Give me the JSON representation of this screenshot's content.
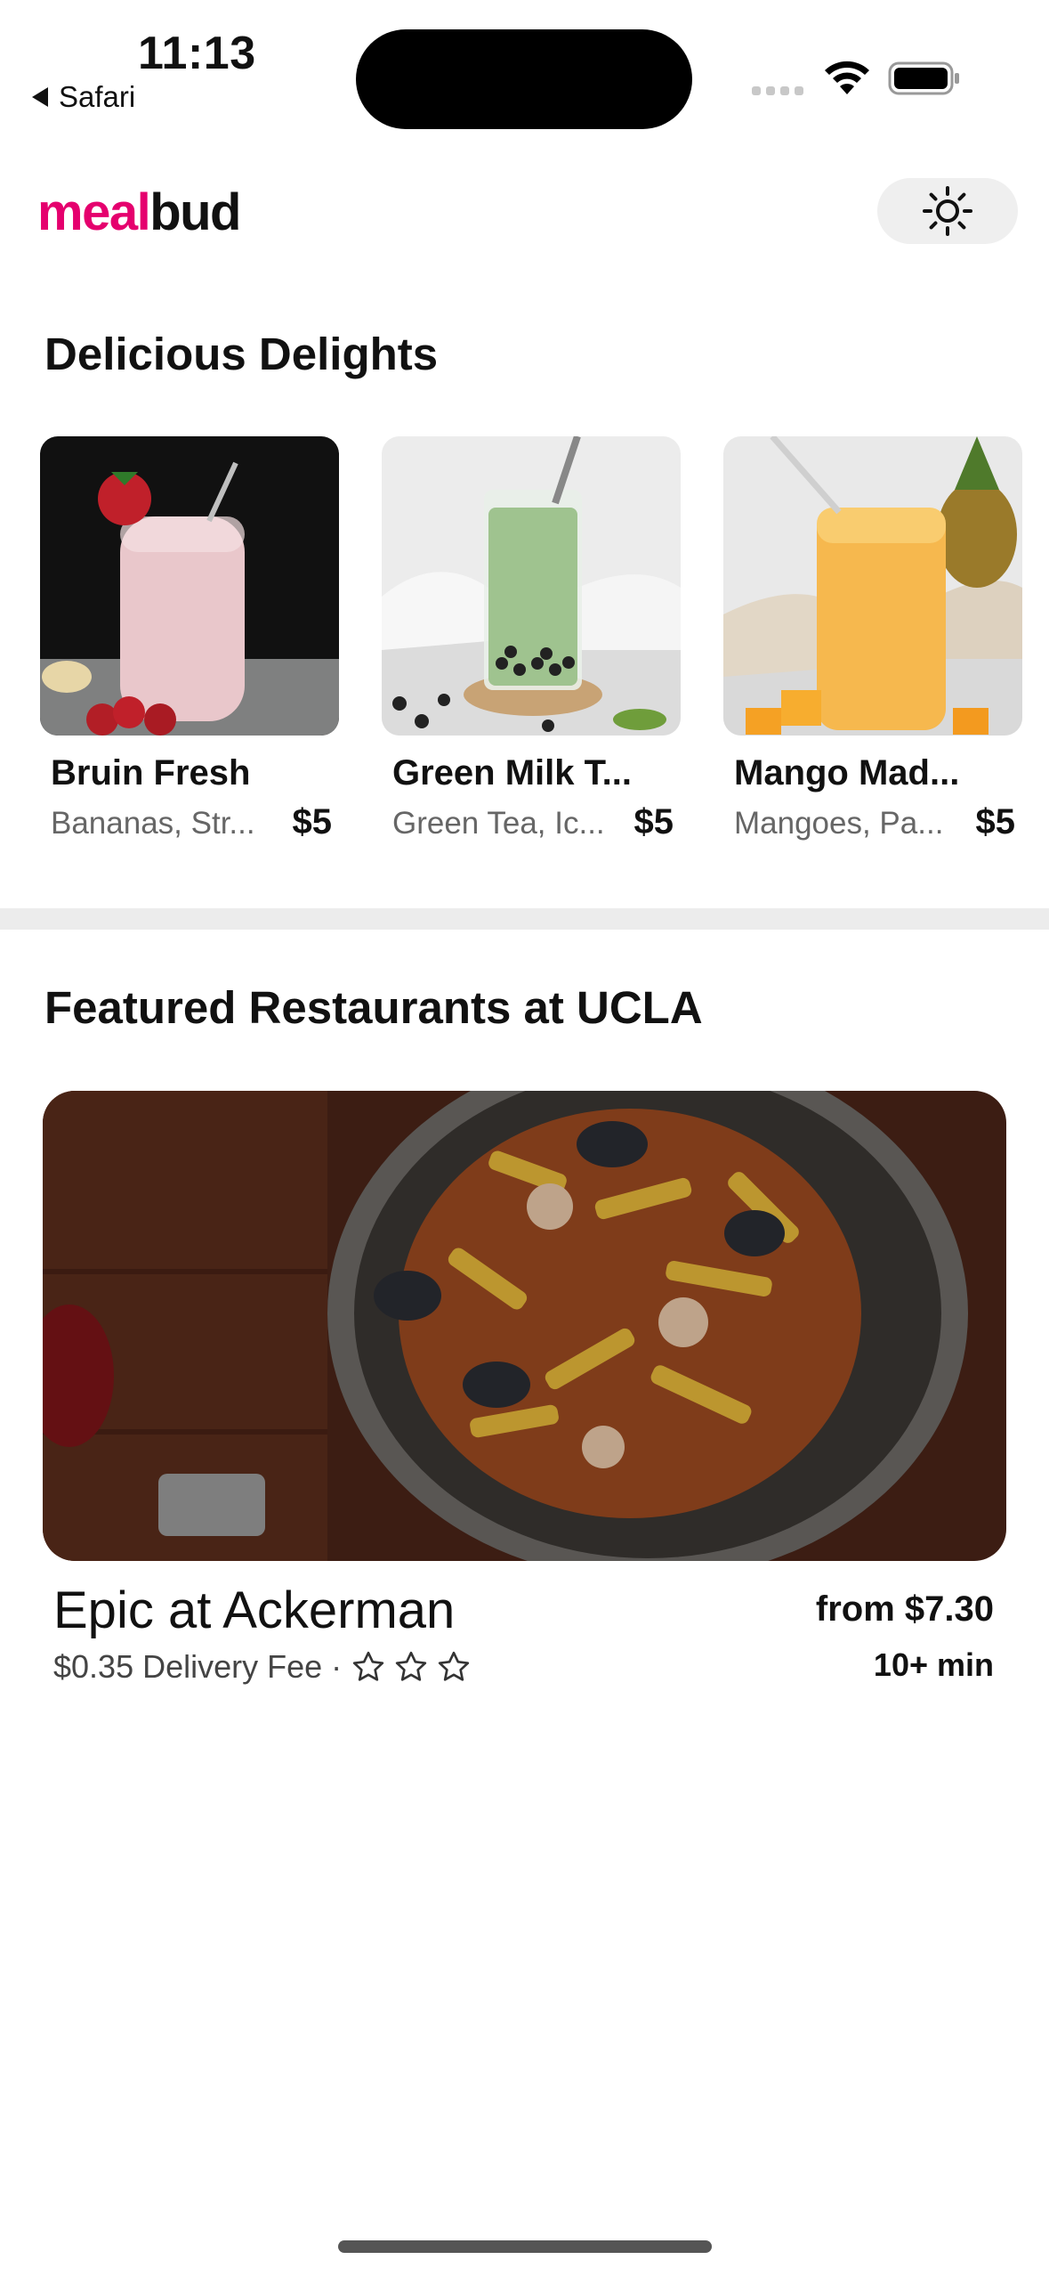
{
  "status_bar": {
    "time": "11:13",
    "back_app": "Safari",
    "icons": [
      "cellular-signal-icon",
      "wifi-icon",
      "battery-icon"
    ]
  },
  "header": {
    "logo_part1": "meal",
    "logo_part2": "bud",
    "brand_color": "#e5006e",
    "theme_toggle_icon": "sun-icon"
  },
  "delights": {
    "title": "Delicious Delights",
    "items": [
      {
        "name": "Bruin Fresh",
        "description": "Bananas, Str...",
        "price": "$5"
      },
      {
        "name": "Green Milk T...",
        "description": "Green Tea, Ic...",
        "price": "$5"
      },
      {
        "name": "Mango Mad...",
        "description": "Mangoes, Pa...",
        "price": "$5"
      }
    ]
  },
  "restaurants": {
    "title": "Featured Restaurants at UCLA",
    "items": [
      {
        "name": "Epic at Ackerman",
        "price": "from $7.30",
        "delivery_fee": "$0.35 Delivery Fee",
        "separator": "·",
        "rating_stars": 0,
        "rating_max": 3,
        "time": "10+ min"
      }
    ]
  }
}
